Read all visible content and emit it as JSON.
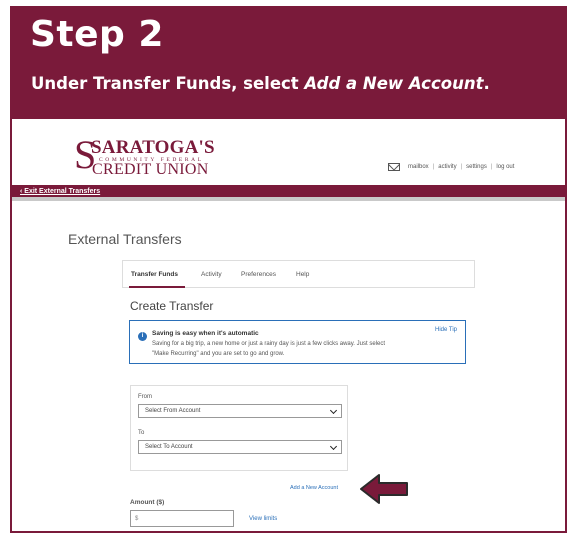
{
  "slide": {
    "step_title": "Step 2",
    "instruction_prefix": "Under Transfer Funds, select ",
    "instruction_emphasis": "Add a New Account",
    "instruction_suffix": ".",
    "banner_color": "#7a1a3a"
  },
  "logo": {
    "line1": "SARATOGA'S",
    "line2": "COMMUNITY FEDERAL",
    "line3": "CREDIT UNION"
  },
  "top_nav": {
    "icon": "mail-icon",
    "items": [
      "mailbox",
      "activity",
      "settings",
      "log out"
    ]
  },
  "exit_link": "‹ Exit External Transfers",
  "page_title": "External Transfers",
  "tabs": [
    {
      "label": "Transfer Funds",
      "active": true
    },
    {
      "label": "Activity",
      "active": false
    },
    {
      "label": "Preferences",
      "active": false
    },
    {
      "label": "Help",
      "active": false
    }
  ],
  "create_title": "Create Transfer",
  "info": {
    "icon": "info-icon",
    "heading": "Saving is easy when it's automatic",
    "line1": "Saving for a big trip, a new home or just a rainy day is just a few clicks away. Just select",
    "line2": "\"Make Recurring\" and you are set to go and grow.",
    "hide_tip": "Hide Tip",
    "accent_color": "#2a6fb8"
  },
  "form": {
    "from_label": "From",
    "from_value": "Select From Account",
    "to_label": "To",
    "to_value": "Select To Account"
  },
  "add_account_link": "Add a New Account",
  "amount": {
    "label": "Amount ($)",
    "value": "$",
    "view_limits": "View limits"
  }
}
